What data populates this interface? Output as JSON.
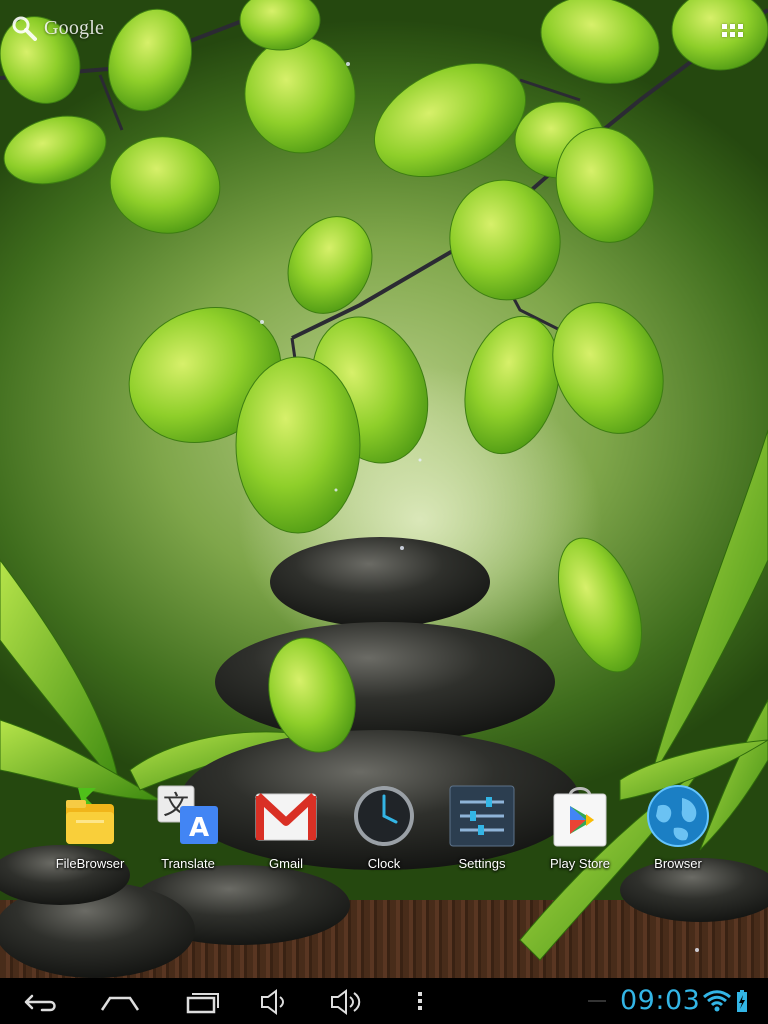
{
  "search_widget": {
    "label": "Google",
    "icon": "search-icon"
  },
  "apps_button": {
    "icon": "all-apps-grid-icon"
  },
  "dock": {
    "apps": [
      {
        "label": "FileBrowser",
        "icon": "file-browser-icon"
      },
      {
        "label": "Translate",
        "icon": "translate-icon"
      },
      {
        "label": "Gmail",
        "icon": "gmail-icon"
      },
      {
        "label": "Clock",
        "icon": "clock-icon"
      },
      {
        "label": "Settings",
        "icon": "settings-icon"
      },
      {
        "label": "Play Store",
        "icon": "play-store-icon"
      },
      {
        "label": "Browser",
        "icon": "browser-globe-icon"
      }
    ]
  },
  "navbar": {
    "buttons": [
      "back-icon",
      "home-icon",
      "recent-apps-icon",
      "volume-down-icon",
      "volume-up-icon",
      "menu-dots-icon"
    ]
  },
  "status": {
    "time": "09:03",
    "wifi_icon": "wifi-icon",
    "battery_icon": "battery-charging-icon",
    "accent_color": "#33b5e5"
  }
}
